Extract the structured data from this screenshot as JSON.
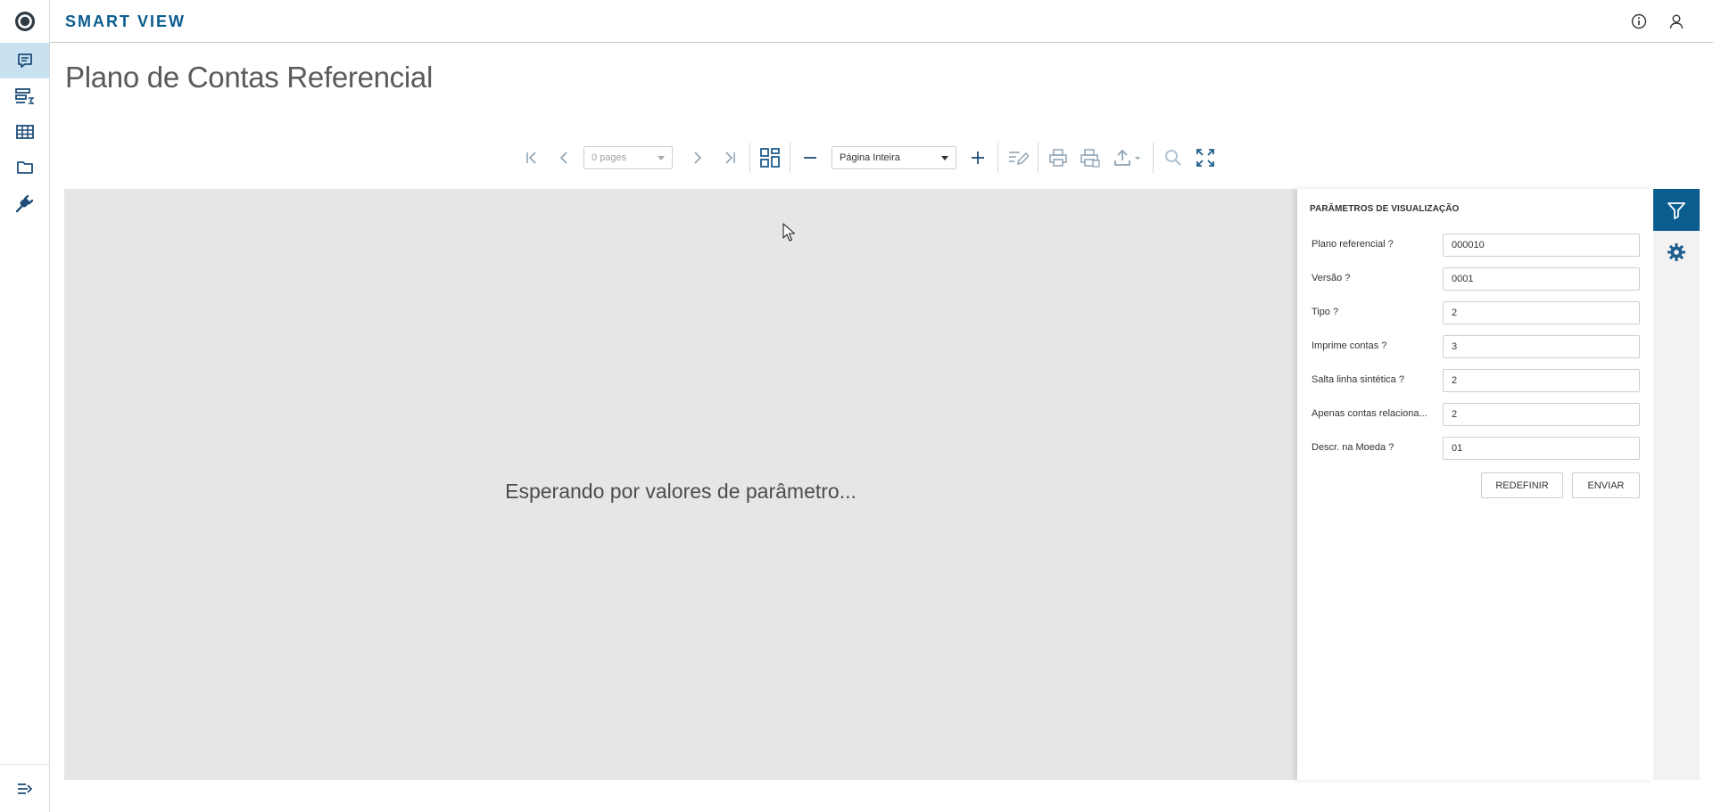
{
  "app": {
    "brand": "SMART VIEW"
  },
  "page": {
    "title": "Plano de Contas Referencial"
  },
  "header": {
    "info_icon": "info-icon",
    "user_icon": "user-icon"
  },
  "toolbar": {
    "pages_select": "0 pages",
    "zoom_select": "Página Inteira"
  },
  "viewer": {
    "message": "Esperando por valores de parâmetro..."
  },
  "params": {
    "title": "PARÂMETROS DE VISUALIZAÇÃO",
    "fields": [
      {
        "label": "Plano referencial ?",
        "value": "000010"
      },
      {
        "label": "Versão ?",
        "value": "0001"
      },
      {
        "label": "Tipo ?",
        "value": "2"
      },
      {
        "label": "Imprime contas ?",
        "value": "3"
      },
      {
        "label": "Salta linha sintética ?",
        "value": "2"
      },
      {
        "label": "Apenas contas relaciona...",
        "value": "2"
      },
      {
        "label": "Descr. na Moeda ?",
        "value": "01"
      }
    ],
    "reset_label": "REDEFINIR",
    "submit_label": "ENVIAR"
  },
  "colors": {
    "accent": "#0b5c8f",
    "rail_active": "#c9e2f2",
    "viewer_bg": "#e6e6e6"
  }
}
